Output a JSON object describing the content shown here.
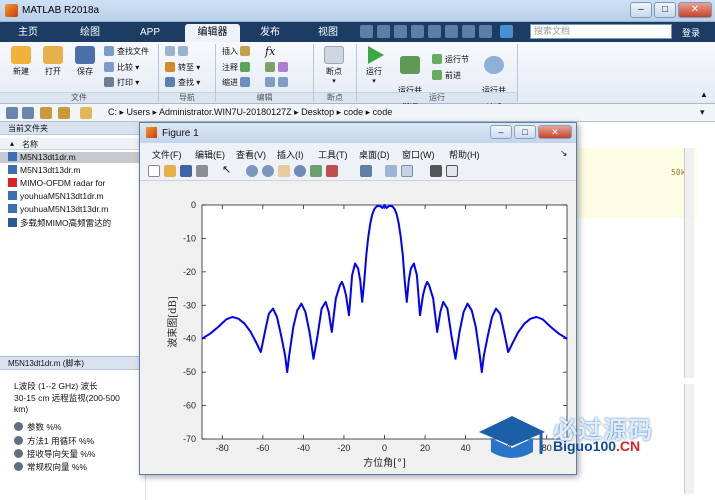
{
  "app": {
    "title": "MATLAB R2018a"
  },
  "tabs": [
    "主页",
    "绘图",
    "APP",
    "编辑器",
    "发布",
    "视图"
  ],
  "search": {
    "placeholder": "搜索文档"
  },
  "login": "登录",
  "ribbon": {
    "file_group": {
      "new": "新建",
      "open": "打开",
      "save": "保存",
      "find_files": "查找文件",
      "compare": "比较",
      "print": "打印",
      "label": "文件"
    },
    "nav_group": {
      "goto": "转至",
      "find": "查找",
      "label": "导航"
    },
    "edit_group": {
      "insert": "插入",
      "comment": "注释",
      "indent": "缩进",
      "fx": "fx",
      "label": "编辑"
    },
    "breakpoints_group": {
      "breakpoints": "断点",
      "label": "断点"
    },
    "run_group": {
      "run": "运行",
      "run_advance": "运行并\n前进",
      "run_section": "运行节",
      "advance": "前进",
      "run_time": "运行并\n计时",
      "label": "运行"
    }
  },
  "address": {
    "path": "C: ▸ Users ▸ Administrator.WIN7U-20180127Z ▸ Desktop ▸ code ▸ code"
  },
  "left_panel": {
    "title": "当前文件夹",
    "col_name": "名称",
    "files": [
      {
        "name": "M5N13dt1dr.m",
        "selected": true
      },
      {
        "name": "M5N13dt13dr.m",
        "selected": false
      },
      {
        "name": "MIMO-OFDM radar for",
        "selected": false
      },
      {
        "name": "youhuaM5N13dt1dr.m",
        "selected": false
      },
      {
        "name": "youhuaM5N13dt13dr.m",
        "selected": false
      },
      {
        "name": "多载频MIMO高频雷达的",
        "selected": false
      }
    ],
    "details_title": "M5N13dt1dr.m (脚本)",
    "details_text": [
      "L波段 (1--2 GHz) 波长",
      "30-15 cm 远程监视(200-500",
      "km)"
    ],
    "details_items": [
      "参数 %%",
      "方法1 用循环 %%",
      "接收导向矢量 %%",
      "常规权向量 %%"
    ]
  },
  "editor": {
    "visible_text": "50km)"
  },
  "figure": {
    "title": "Figure 1",
    "menu": [
      "文件(F)",
      "编辑(E)",
      "查看(V)",
      "插入(I)",
      "工具(T)",
      "桌面(D)",
      "窗口(W)",
      "帮助(H)"
    ]
  },
  "watermark": {
    "big": "必过源码",
    "small_prefix": "Biguo100",
    "small_suffix": ".CN"
  },
  "chart_data": {
    "type": "line",
    "xlabel": "方位角[°]",
    "ylabel": "波束图[dB]",
    "xlim": [
      -90,
      90
    ],
    "ylim": [
      -70,
      0
    ],
    "xticks": [
      -80,
      -60,
      -40,
      -20,
      0,
      20,
      40,
      60,
      80
    ],
    "yticks": [
      0,
      -10,
      -20,
      -30,
      -40,
      -50,
      -60,
      -70
    ],
    "color": "#0000ff",
    "series": [
      {
        "x": [
          -90,
          -86,
          -82,
          -78,
          -75,
          -72,
          -69,
          -66,
          -63,
          -61,
          -59,
          -57,
          -55,
          -53,
          -51,
          -49,
          -48,
          -47,
          -45,
          -43,
          -41,
          -39,
          -37,
          -35,
          -33,
          -31,
          -29,
          -27.5,
          -26,
          -24,
          -22,
          -21,
          -20,
          -19,
          -17.5,
          -16,
          -14.5,
          -13,
          -12,
          -11,
          -10,
          -9,
          -8,
          -7,
          -6,
          -5,
          -4,
          -3,
          -2,
          -1,
          0,
          1,
          2,
          3,
          4,
          5,
          6,
          7,
          8,
          9,
          10,
          11,
          12,
          13,
          14.5,
          16,
          17.5,
          19,
          20,
          21,
          22,
          24,
          26,
          27.5,
          29,
          31,
          33,
          35,
          37,
          39,
          41,
          43,
          45,
          47,
          48,
          49,
          51,
          53,
          55,
          57,
          59,
          61,
          63,
          66,
          69,
          72,
          75,
          78,
          82,
          86,
          90
        ],
        "y": [
          -40,
          -38.5,
          -36.5,
          -34.2,
          -33.5,
          -34,
          -35.5,
          -38,
          -41.5,
          -44,
          -38,
          -32.5,
          -31,
          -33.5,
          -39,
          -45,
          -50,
          -45,
          -36.5,
          -31.5,
          -29.5,
          -32,
          -38,
          -46,
          -39,
          -31,
          -29,
          -32,
          -38,
          -28,
          -24,
          -23,
          -24.5,
          -27,
          -33,
          -21,
          -17.5,
          -19,
          -22.5,
          -29,
          -23,
          -15,
          -9.5,
          -5.5,
          -2.8,
          -1.2,
          -0.5,
          -0.2,
          -0.4,
          -0.9,
          0,
          -0.9,
          -0.4,
          -0.2,
          -0.5,
          -1.2,
          -2.8,
          -5.5,
          -9.5,
          -15,
          -23,
          -29,
          -22.5,
          -19,
          -17.5,
          -21,
          -33,
          -27,
          -24.5,
          -23,
          -24,
          -28,
          -38,
          -32,
          -29,
          -31,
          -39,
          -46,
          -38,
          -32,
          -29.5,
          -31.5,
          -36.5,
          -45,
          -50,
          -45,
          -39,
          -33.5,
          -31,
          -32.5,
          -38,
          -44,
          -41.5,
          -38,
          -35.5,
          -34,
          -33.5,
          -34.2,
          -36.5,
          -38.5,
          -40
        ]
      }
    ]
  }
}
